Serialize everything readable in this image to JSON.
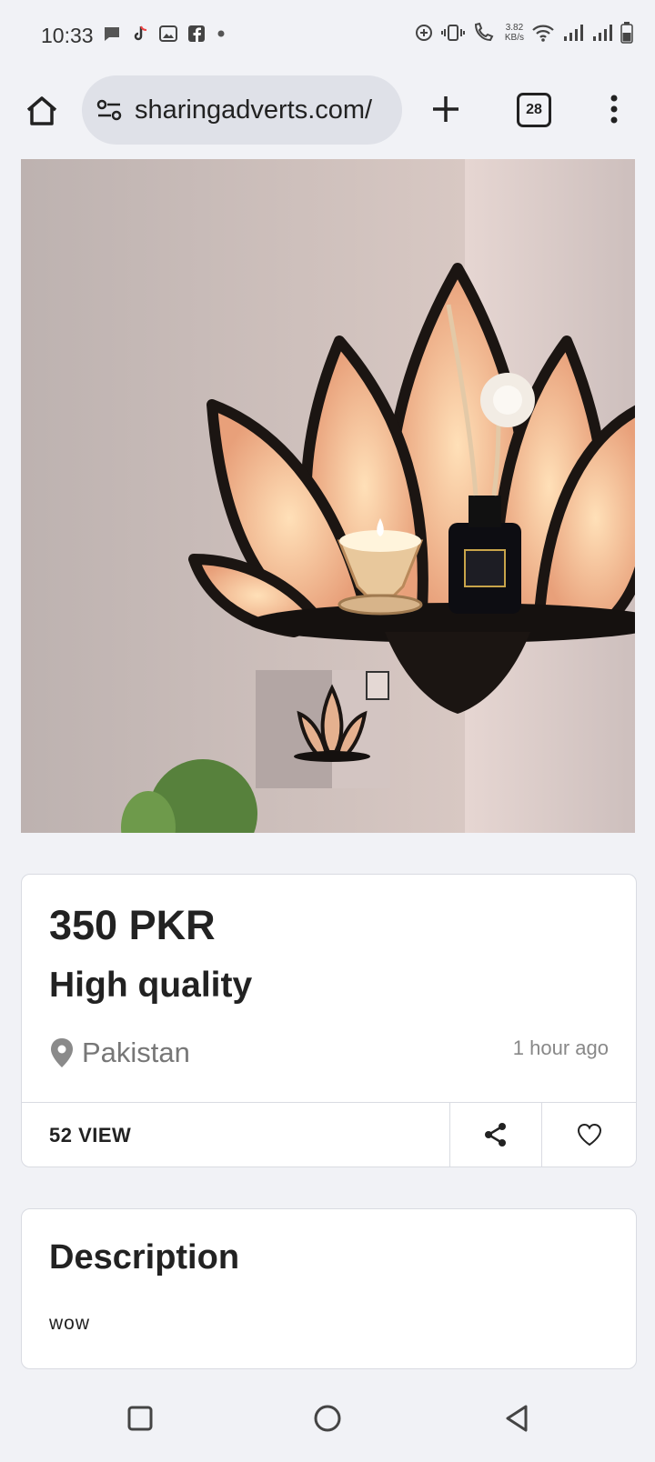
{
  "status_bar": {
    "time": "10:33",
    "net_speed_value": "3.82",
    "net_speed_unit": "KB/s",
    "sim1": "1",
    "sim2": "2",
    "left_icons": [
      "chat-bubble-icon",
      "tiktok-icon",
      "gallery-icon",
      "facebook-icon",
      "dot-icon"
    ],
    "right_icons": [
      "data-saver-icon",
      "vibrate-icon",
      "volte-call-icon",
      "wifi-icon",
      "signal-1-icon",
      "signal-2-icon",
      "battery-icon"
    ]
  },
  "browser": {
    "url": "sharingadverts.com/",
    "tab_count": "28",
    "icons": [
      "home-icon",
      "site-settings-icon",
      "new-tab-icon",
      "tabs-icon",
      "more-vert-icon"
    ]
  },
  "listing": {
    "price": "350 PKR",
    "title": "High quality",
    "location": "Pakistan",
    "posted": "1 hour ago",
    "views": "52 VIEW",
    "image_alt": "Lotus corner shelf with candle"
  },
  "description": {
    "heading": "Description",
    "body": "wow"
  },
  "nav": {
    "icons": [
      "recents-icon",
      "home-circle-icon",
      "back-icon"
    ]
  },
  "colors": {
    "background": "#f1f2f6",
    "card": "#ffffff",
    "text": "#222222",
    "muted": "#777777"
  }
}
